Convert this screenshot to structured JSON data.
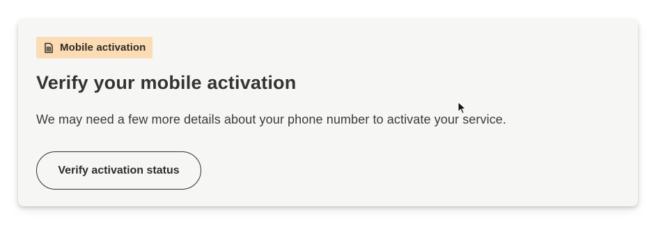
{
  "card": {
    "badge": {
      "icon": "sim-card-icon",
      "label": "Mobile activation",
      "background": "#fbdcb4"
    },
    "title": "Verify your mobile activation",
    "description": "We may need a few more details about your phone number to activate your service.",
    "button_label": "Verify activation status"
  }
}
